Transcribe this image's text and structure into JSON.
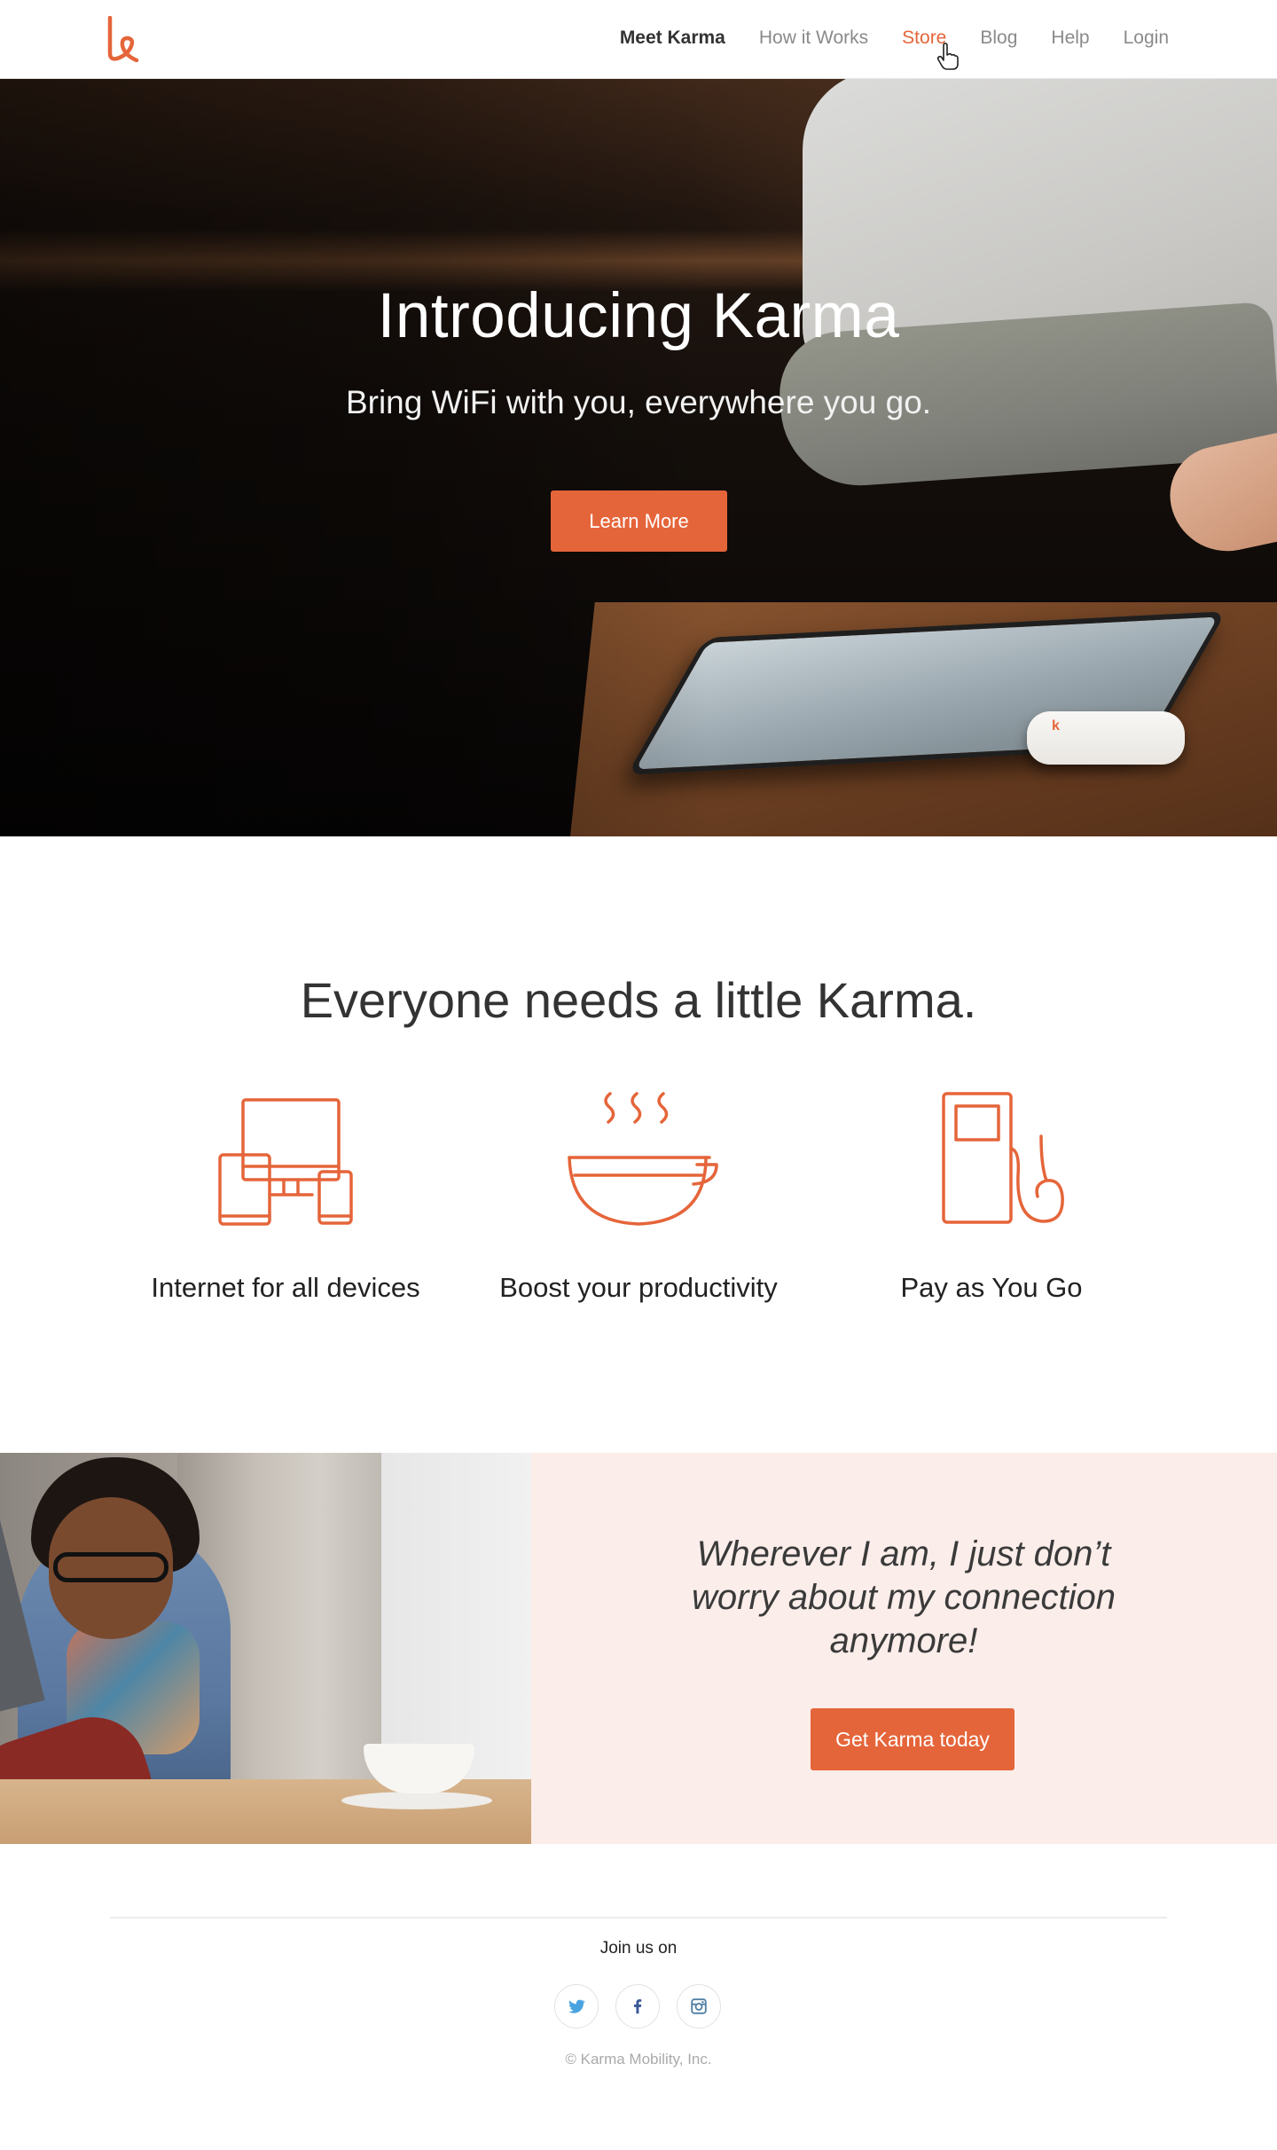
{
  "brand": {
    "logo_icon": "karma-logo-icon",
    "accent_color": "#e5653a"
  },
  "nav": {
    "items": [
      {
        "label": "Meet Karma",
        "state": "bold"
      },
      {
        "label": "How it Works",
        "state": "normal"
      },
      {
        "label": "Store",
        "state": "active"
      },
      {
        "label": "Blog",
        "state": "normal"
      },
      {
        "label": "Help",
        "state": "normal"
      },
      {
        "label": "Login",
        "state": "normal"
      }
    ],
    "cursor_icon": "hand-pointer-icon"
  },
  "hero": {
    "title": "Introducing Karma",
    "subtitle": "Bring WiFi with you, everywhere you go.",
    "button_label": "Learn More",
    "device_mark": "k"
  },
  "features": {
    "title": "Everyone needs a little Karma.",
    "items": [
      {
        "label": "Internet for all devices",
        "icon": "devices-icon"
      },
      {
        "label": "Boost your productivity",
        "icon": "coffee-cup-icon"
      },
      {
        "label": "Pay as You Go",
        "icon": "fuel-pump-icon"
      }
    ]
  },
  "testimonial": {
    "quote": "Wherever I am, I just don’t worry about my connection anymore!",
    "button_label": "Get Karma today",
    "panel_color": "#fbede9"
  },
  "footer": {
    "join_label": "Join us on",
    "social": [
      {
        "icon": "twitter-icon",
        "color": "#4aa3df"
      },
      {
        "icon": "facebook-icon",
        "color": "#3b5998"
      },
      {
        "icon": "instagram-icon",
        "color": "#517fa4"
      }
    ],
    "copyright": "© Karma Mobility, Inc."
  }
}
